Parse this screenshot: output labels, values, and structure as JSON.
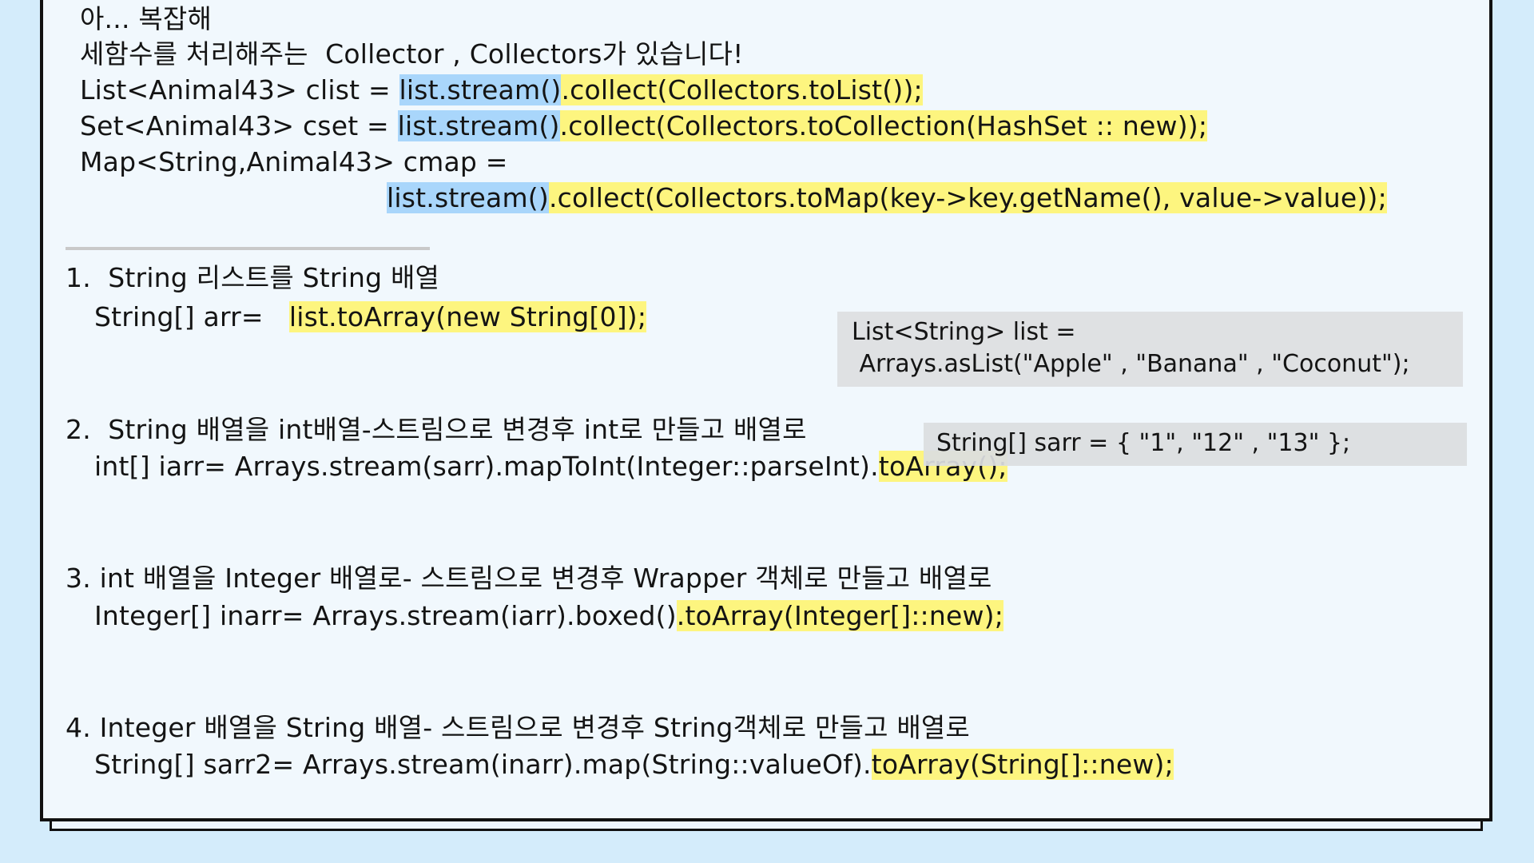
{
  "top": {
    "line1": "아... 복잡해",
    "line2": "세함수를 처리해주는  Collector , Collectors가 있습니다!",
    "clist": {
      "pre": "List<Animal43> clist = ",
      "stream": "list.stream()",
      "collect": ".collect(Collectors.toList());"
    },
    "cset": {
      "pre": "Set<Animal43> cset = ",
      "stream": "list.stream()",
      "collect": ".collect(Collectors.toCollection(HashSet :: new));"
    },
    "cmap_decl": "Map<String,Animal43> cmap =",
    "cmap": {
      "stream": "list.stream()",
      "collect": ".collect(Collectors.toMap(key->key.getName(), value->value));"
    }
  },
  "sections": [
    {
      "title": "1.  String 리스트를 String 배열",
      "code_pre": "String[] arr=   ",
      "code_hl": "list.toArray(new String[0]);"
    },
    {
      "title": "2.  String 배열을 int배열-스트림으로 변경후 int로 만들고 배열로",
      "code_pre": "int[] iarr= Arrays.stream(sarr).mapToInt(Integer::parseInt).",
      "code_hl": "toArray();"
    },
    {
      "title": "3. int 배열을 Integer 배열로- 스트림으로 변경후 Wrapper 객체로 만들고 배열로",
      "code_pre": "Integer[] inarr= Arrays.stream(iarr).boxed()",
      "code_hl": ".toArray(Integer[]::new);"
    },
    {
      "title": "4. Integer 배열을 String 배열- 스트림으로 변경후 String객체로 만들고 배열로",
      "code_pre": "String[] sarr2= Arrays.stream(inarr).map(String::valueOf).",
      "code_hl": "toArray(String[]::new);"
    }
  ],
  "boxes": {
    "list_line1": "List<String> list =",
    "list_line2": " Arrays.asList(\"Apple\" , \"Banana\" , \"Coconut\");",
    "sarr_line": "String[] sarr = { \"1\", \"12\" , \"13\" };"
  }
}
